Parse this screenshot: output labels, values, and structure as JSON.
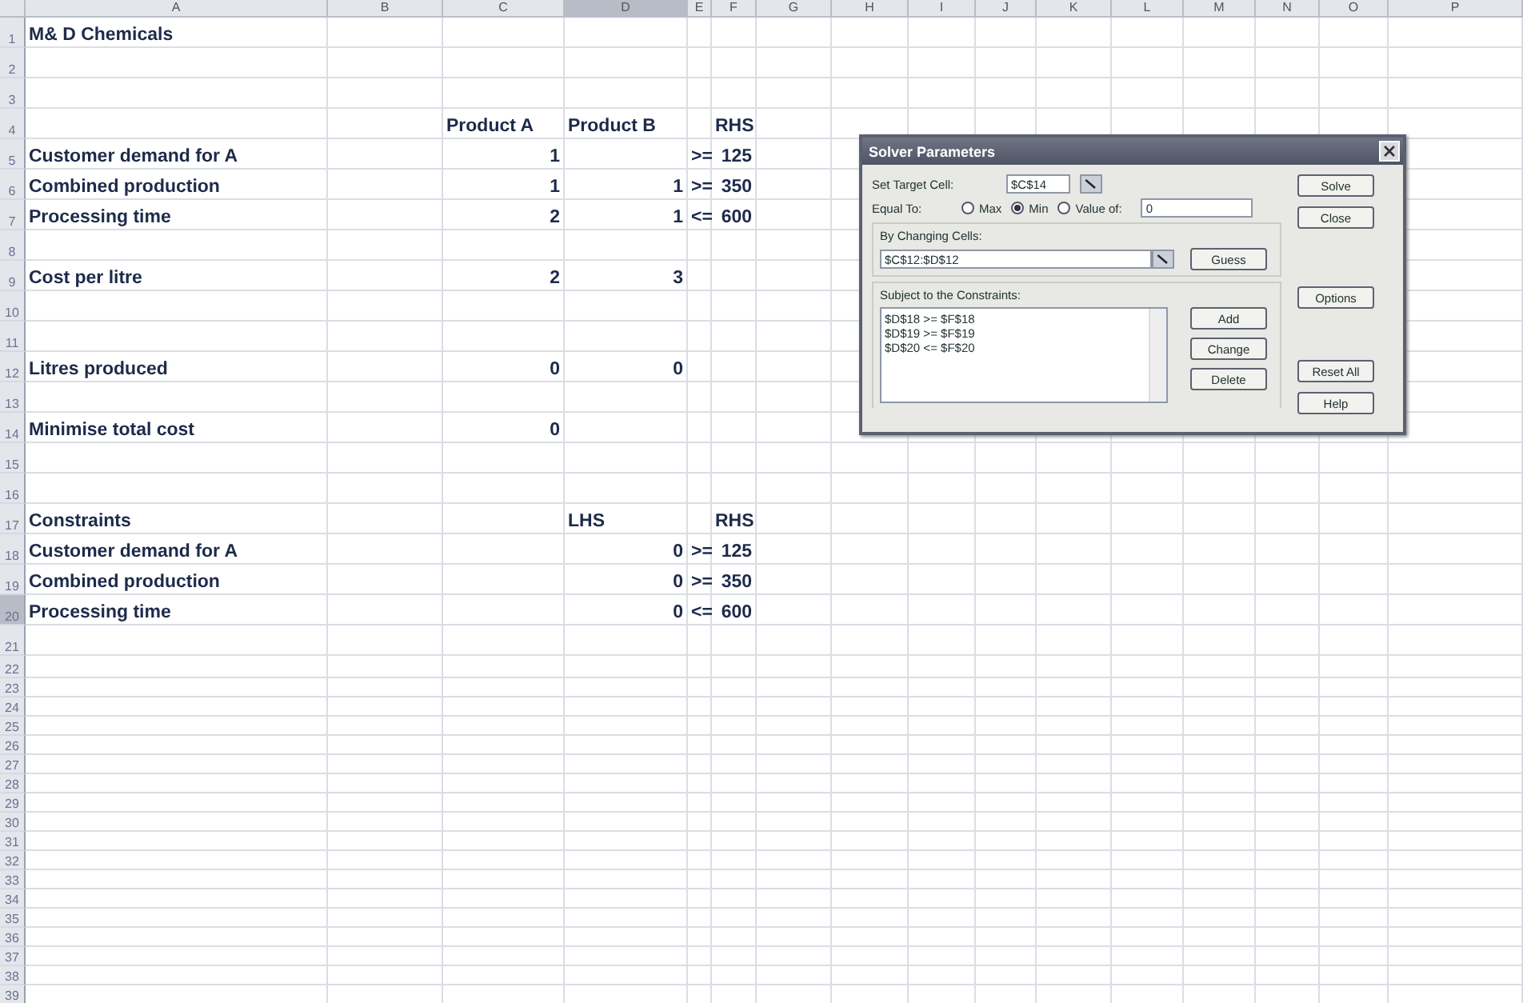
{
  "columns": [
    {
      "label": "A",
      "selected": false
    },
    {
      "label": "B",
      "selected": false
    },
    {
      "label": "C",
      "selected": false
    },
    {
      "label": "D",
      "selected": true
    },
    {
      "label": "E",
      "selected": false
    },
    {
      "label": "F",
      "selected": false
    },
    {
      "label": "G",
      "selected": false
    },
    {
      "label": "H",
      "selected": false
    },
    {
      "label": "I",
      "selected": false
    },
    {
      "label": "J",
      "selected": false
    },
    {
      "label": "K",
      "selected": false
    },
    {
      "label": "L",
      "selected": false
    },
    {
      "label": "M",
      "selected": false
    },
    {
      "label": "N",
      "selected": false
    },
    {
      "label": "O",
      "selected": false
    },
    {
      "label": "P",
      "selected": false
    }
  ],
  "rows": [
    {
      "number": "1",
      "selected": false,
      "cells": {
        "A": {
          "kind": "label",
          "text": "M& D Chemicals"
        }
      }
    },
    {
      "number": "2",
      "selected": false
    },
    {
      "number": "3",
      "selected": false
    },
    {
      "number": "4",
      "selected": false,
      "cells": {
        "C": {
          "kind": "label",
          "text": "Product A"
        },
        "D": {
          "kind": "label",
          "text": "Product B"
        },
        "F": {
          "kind": "label",
          "text": "RHS"
        }
      }
    },
    {
      "number": "5",
      "selected": false,
      "cells": {
        "A": {
          "kind": "label",
          "text": "Customer demand for A"
        },
        "C": {
          "kind": "number",
          "text": "1"
        },
        "E": {
          "kind": "label",
          "text": ">="
        },
        "F": {
          "kind": "number",
          "text": "125"
        }
      }
    },
    {
      "number": "6",
      "selected": false,
      "cells": {
        "A": {
          "kind": "label",
          "text": "Combined production"
        },
        "C": {
          "kind": "number",
          "text": "1"
        },
        "D": {
          "kind": "number",
          "text": "1"
        },
        "E": {
          "kind": "label",
          "text": ">="
        },
        "F": {
          "kind": "number",
          "text": "350"
        }
      }
    },
    {
      "number": "7",
      "selected": false,
      "cells": {
        "A": {
          "kind": "label",
          "text": "Processing time"
        },
        "C": {
          "kind": "number",
          "text": "2"
        },
        "D": {
          "kind": "number",
          "text": "1"
        },
        "E": {
          "kind": "label",
          "text": "<="
        },
        "F": {
          "kind": "number",
          "text": "600"
        }
      }
    },
    {
      "number": "8",
      "selected": false
    },
    {
      "number": "9",
      "selected": false,
      "cells": {
        "A": {
          "kind": "label",
          "text": "Cost per litre"
        },
        "C": {
          "kind": "number",
          "text": "2"
        },
        "D": {
          "kind": "number",
          "text": "3"
        }
      }
    },
    {
      "number": "10",
      "selected": false
    },
    {
      "number": "11",
      "selected": false
    },
    {
      "number": "12",
      "selected": false,
      "cells": {
        "A": {
          "kind": "label",
          "text": "Litres produced"
        },
        "C": {
          "kind": "number",
          "text": "0"
        },
        "D": {
          "kind": "number",
          "text": "0"
        }
      }
    },
    {
      "number": "13",
      "selected": false
    },
    {
      "number": "14",
      "selected": false,
      "cells": {
        "A": {
          "kind": "label",
          "text": "Minimise total cost"
        },
        "C": {
          "kind": "number",
          "text": "0"
        }
      }
    },
    {
      "number": "15",
      "selected": false
    },
    {
      "number": "16",
      "selected": false
    },
    {
      "number": "17",
      "selected": false,
      "cells": {
        "A": {
          "kind": "label",
          "text": "Constraints"
        },
        "D": {
          "kind": "label",
          "text": "LHS"
        },
        "F": {
          "kind": "label",
          "text": "RHS"
        }
      }
    },
    {
      "number": "18",
      "selected": false,
      "cells": {
        "A": {
          "kind": "label",
          "text": "Customer demand for A"
        },
        "D": {
          "kind": "number",
          "text": "0"
        },
        "E": {
          "kind": "label",
          "text": ">="
        },
        "F": {
          "kind": "number",
          "text": "125"
        }
      }
    },
    {
      "number": "19",
      "selected": false,
      "cells": {
        "A": {
          "kind": "label",
          "text": "Combined production"
        },
        "D": {
          "kind": "number",
          "text": "0"
        },
        "E": {
          "kind": "label",
          "text": ">="
        },
        "F": {
          "kind": "number",
          "text": "350"
        }
      }
    },
    {
      "number": "20",
      "selected": true,
      "cells": {
        "A": {
          "kind": "label",
          "text": "Processing time"
        },
        "D": {
          "kind": "number",
          "text": "0"
        },
        "E": {
          "kind": "label",
          "text": "<="
        },
        "F": {
          "kind": "number",
          "text": "600"
        }
      }
    },
    {
      "number": "21",
      "selected": false
    },
    {
      "number": "22",
      "selected": false
    },
    {
      "number": "23",
      "selected": false
    },
    {
      "number": "24",
      "selected": false
    },
    {
      "number": "25",
      "selected": false
    },
    {
      "number": "26",
      "selected": false
    },
    {
      "number": "27",
      "selected": false
    },
    {
      "number": "28",
      "selected": false
    },
    {
      "number": "29",
      "selected": false
    },
    {
      "number": "30",
      "selected": false
    },
    {
      "number": "31",
      "selected": false
    },
    {
      "number": "32",
      "selected": false
    },
    {
      "number": "33",
      "selected": false
    },
    {
      "number": "34",
      "selected": false
    },
    {
      "number": "35",
      "selected": false
    },
    {
      "number": "36",
      "selected": false
    },
    {
      "number": "37",
      "selected": false
    },
    {
      "number": "38",
      "selected": false
    },
    {
      "number": "39",
      "selected": false
    }
  ],
  "dialog": {
    "title": "Solver Parameters",
    "target_label": "Set Target Cell:",
    "target_value": "$C$14",
    "equal_to_label": "Equal To:",
    "options": [
      {
        "label": "Max",
        "selected": false
      },
      {
        "label": "Min",
        "selected": true
      },
      {
        "label": "Value of:",
        "selected": false
      }
    ],
    "value_of": "0",
    "changing_label": "By Changing Cells:",
    "changing_value": "$C$12:$D$12",
    "guess_button": "Guess",
    "constraints_label": "Subject to the Constraints:",
    "constraints": [
      "$D$18 >= $F$18",
      "$D$19 >= $F$19",
      "$D$20 <= $F$20"
    ],
    "constraint_buttons": [
      "Add",
      "Change",
      "Delete"
    ],
    "side_buttons": [
      "Solve",
      "Close",
      "Options",
      "Reset All",
      "Help"
    ]
  }
}
